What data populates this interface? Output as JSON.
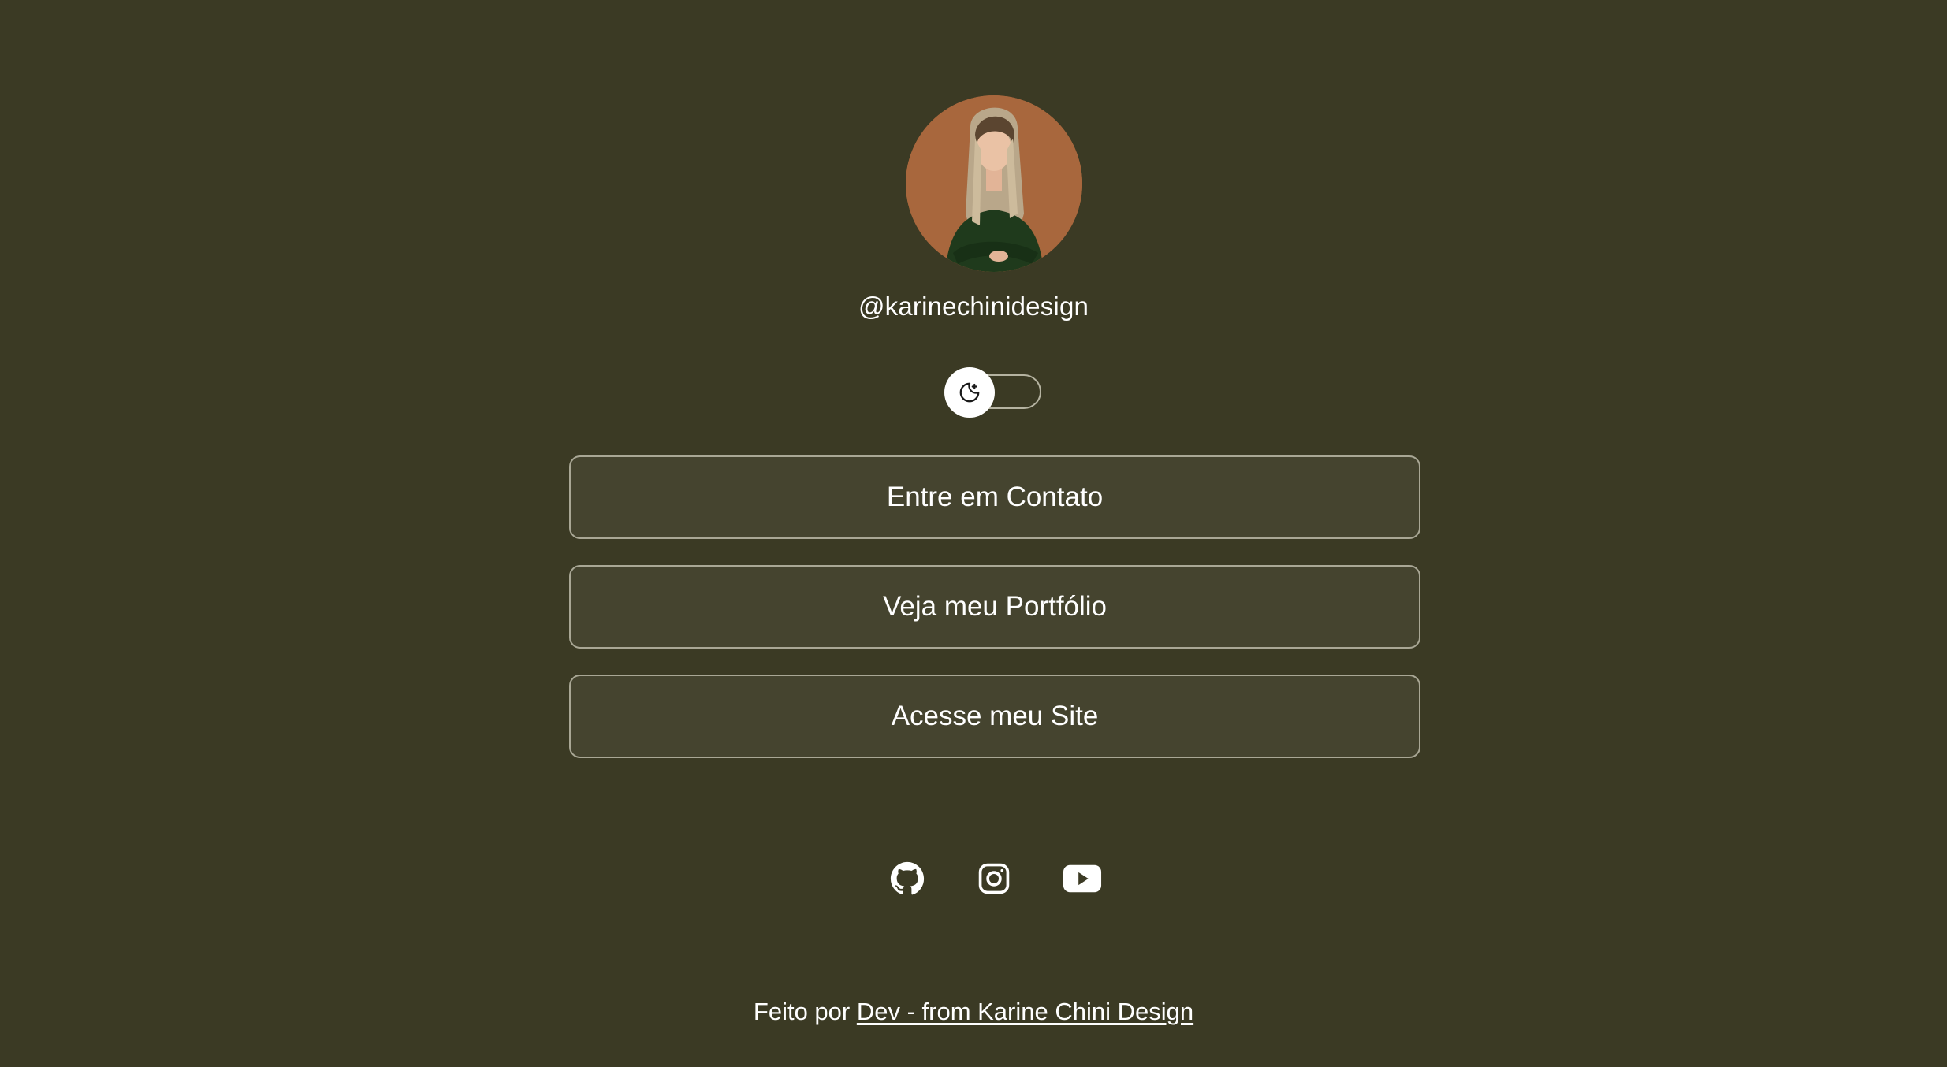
{
  "profile": {
    "username": "@karinechinidesign",
    "avatar_icon": "profile-photo"
  },
  "theme_toggle": {
    "icon": "moon-stars-icon",
    "state": "dark"
  },
  "links": [
    {
      "label": "Entre em Contato"
    },
    {
      "label": "Veja meu Portfólio"
    },
    {
      "label": "Acesse meu Site"
    }
  ],
  "social": [
    {
      "icon": "github-icon"
    },
    {
      "icon": "instagram-icon"
    },
    {
      "icon": "youtube-icon"
    }
  ],
  "footer": {
    "prefix": "Feito por ",
    "link_text": "Dev - from Karine Chini Design"
  },
  "colors": {
    "background": "#3b3a24",
    "button_background": "#45442f",
    "button_border": "#a9a795",
    "avatar_background": "#a8673d",
    "text": "#ffffff"
  }
}
